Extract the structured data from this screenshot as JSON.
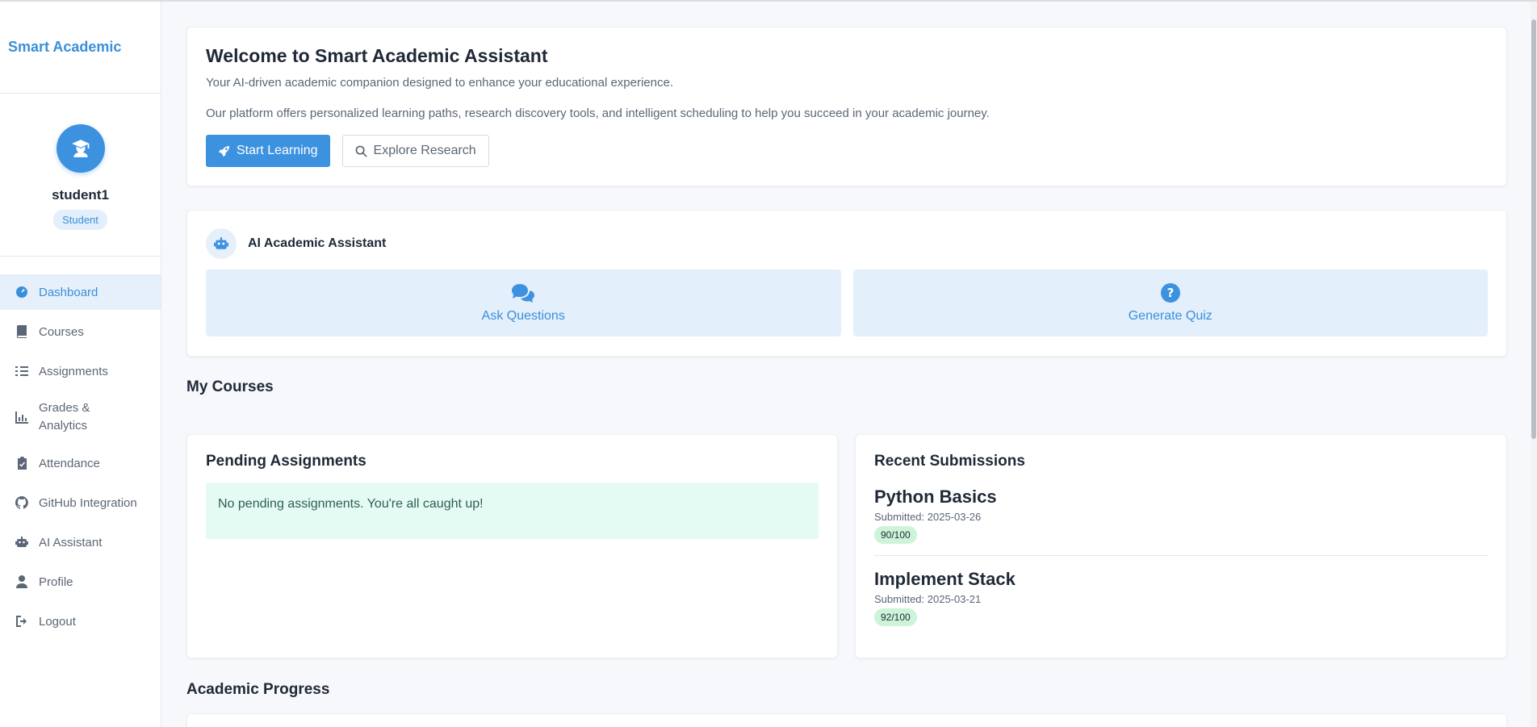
{
  "sidebar": {
    "brand": "Smart Academic",
    "user": {
      "name": "student1",
      "role": "Student",
      "avatar_icon": "user-graduate-icon"
    },
    "items": [
      {
        "label": "Dashboard",
        "icon": "dashboard-icon",
        "active": true
      },
      {
        "label": "Courses",
        "icon": "book-icon"
      },
      {
        "label": "Assignments",
        "icon": "tasks-icon"
      },
      {
        "label": "Grades & Analytics",
        "icon": "chart-icon"
      },
      {
        "label": "Attendance",
        "icon": "clipboard-icon"
      },
      {
        "label": "GitHub Integration",
        "icon": "github-icon"
      },
      {
        "label": "AI Assistant",
        "icon": "robot-icon"
      },
      {
        "label": "Profile",
        "icon": "user-icon"
      },
      {
        "label": "Logout",
        "icon": "logout-icon"
      }
    ]
  },
  "welcome": {
    "title": "Welcome to Smart Academic Assistant",
    "subtitle": "Your AI-driven academic companion designed to enhance your educational experience.",
    "description": "Our platform offers personalized learning paths, research discovery tools, and intelligent scheduling to help you succeed in your academic journey.",
    "start_label": "Start Learning",
    "explore_label": "Explore Research"
  },
  "ai_assistant": {
    "title": "AI Academic Assistant",
    "ask_label": "Ask Questions",
    "quiz_label": "Generate Quiz"
  },
  "sections": {
    "my_courses": "My Courses",
    "academic_progress": "Academic Progress"
  },
  "pending": {
    "title": "Pending Assignments",
    "empty_message": "No pending assignments. You're all caught up!"
  },
  "recent": {
    "title": "Recent Submissions",
    "items": [
      {
        "name": "Python Basics",
        "submitted": "Submitted: 2025-03-26",
        "score": "90/100"
      },
      {
        "name": "Implement Stack",
        "submitted": "Submitted: 2025-03-21",
        "score": "92/100"
      }
    ]
  },
  "colors": {
    "accent": "#3d92e0",
    "success_bg": "#cdf3d9",
    "notice_bg": "#e4fbf4"
  }
}
